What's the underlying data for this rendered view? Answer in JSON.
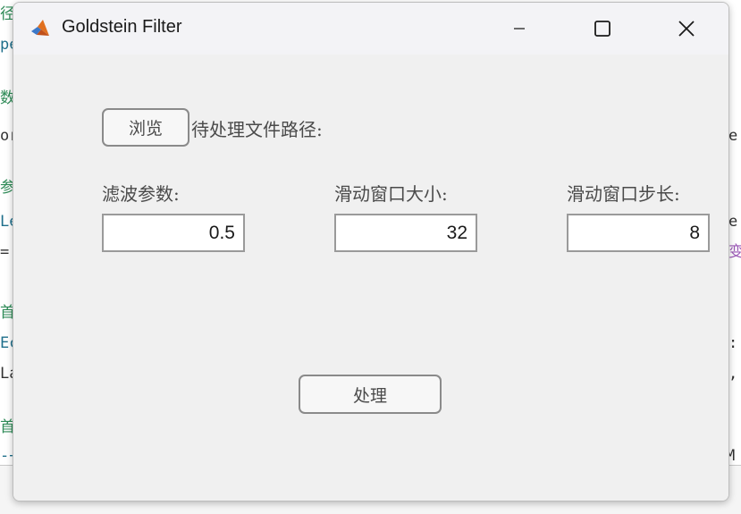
{
  "window": {
    "title": "Goldstein Filter",
    "icon": "matlab-logo-icon",
    "controls": [
      "minimize-icon",
      "maximize-icon",
      "close-icon"
    ]
  },
  "browse": {
    "button_label": "浏览",
    "path_label": "待处理文件路径:"
  },
  "params": [
    {
      "label": "滤波参数:",
      "value": "0.5"
    },
    {
      "label": "滑动窗口大小:",
      "value": "32"
    },
    {
      "label": "滑动窗口步长:",
      "value": "8"
    }
  ],
  "process": {
    "button_label": "处理"
  },
  "colors": {
    "window_bg": "#f0f0f0",
    "titlebar_bg": "#f3f3f6",
    "button_border": "#8a8a8a",
    "text": "#4a4a4a"
  }
}
